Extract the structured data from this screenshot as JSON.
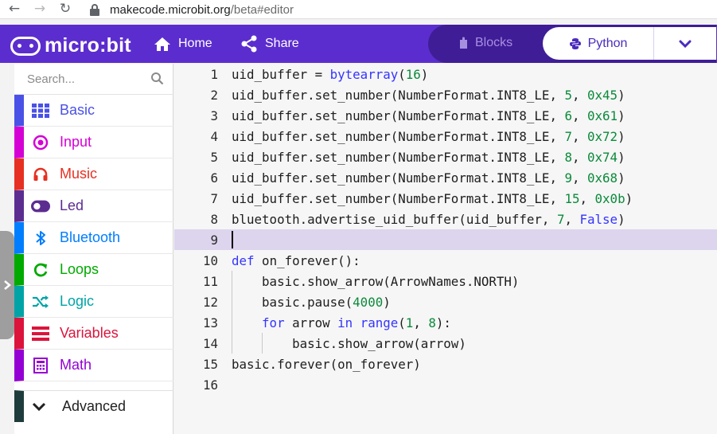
{
  "browser": {
    "url_host": "makecode.microbit.org",
    "url_path": "/beta#editor"
  },
  "menubar": {
    "logo_text": "micro:bit",
    "home_label": "Home",
    "share_label": "Share",
    "blocks_label": "Blocks",
    "python_label": "Python",
    "brand_color": "#5c2dce"
  },
  "toolbox": {
    "search_placeholder": "Search...",
    "categories": [
      {
        "label": "Basic",
        "color": "#4a51e6",
        "icon": "grid-icon"
      },
      {
        "label": "Input",
        "color": "#d400d4",
        "icon": "radio-target-icon"
      },
      {
        "label": "Music",
        "color": "#e63022",
        "icon": "headphones-icon"
      },
      {
        "label": "Led",
        "color": "#5c2d91",
        "icon": "toggle-icon"
      },
      {
        "label": "Bluetooth",
        "color": "#007eff",
        "icon": "bluetooth-icon"
      },
      {
        "label": "Loops",
        "color": "#00aa00",
        "icon": "refresh-icon"
      },
      {
        "label": "Logic",
        "color": "#00a4a6",
        "icon": "shuffle-icon"
      },
      {
        "label": "Variables",
        "color": "#dc143c",
        "icon": "list-icon"
      },
      {
        "label": "Math",
        "color": "#9400d3",
        "icon": "calculator-icon"
      }
    ],
    "advanced_label": "Advanced"
  },
  "editor": {
    "active_line": 9,
    "lines": [
      {
        "n": "1",
        "html": "uid_buffer = <span class='kw'>bytearray</span>(<span class='num'>16</span>)"
      },
      {
        "n": "2",
        "html": "uid_buffer.set_number(NumberFormat.INT8_LE, <span class='num'>5</span>, <span class='num'>0x45</span>)"
      },
      {
        "n": "3",
        "html": "uid_buffer.set_number(NumberFormat.INT8_LE, <span class='num'>6</span>, <span class='num'>0x61</span>)"
      },
      {
        "n": "4",
        "html": "uid_buffer.set_number(NumberFormat.INT8_LE, <span class='num'>7</span>, <span class='num'>0x72</span>)"
      },
      {
        "n": "5",
        "html": "uid_buffer.set_number(NumberFormat.INT8_LE, <span class='num'>8</span>, <span class='num'>0x74</span>)"
      },
      {
        "n": "6",
        "html": "uid_buffer.set_number(NumberFormat.INT8_LE, <span class='num'>9</span>, <span class='num'>0x68</span>)"
      },
      {
        "n": "7",
        "html": "uid_buffer.set_number(NumberFormat.INT8_LE, <span class='num'>15</span>, <span class='num'>0x0b</span>)"
      },
      {
        "n": "8",
        "html": "bluetooth.advertise_uid_buffer(uid_buffer, <span class='num'>7</span>, <span class='kw'>False</span>)"
      },
      {
        "n": "9",
        "html": ""
      },
      {
        "n": "10",
        "html": "<span class='kw'>def</span> on_forever():"
      },
      {
        "n": "11",
        "html": "    basic.show_arrow(ArrowNames.NORTH)"
      },
      {
        "n": "12",
        "html": "    basic.pause(<span class='num'>4000</span>)"
      },
      {
        "n": "13",
        "html": "    <span class='kw'>for</span> arrow <span class='kw'>in</span> <span class='kw'>range</span>(<span class='num'>1</span>, <span class='num'>8</span>):"
      },
      {
        "n": "14",
        "html": "        basic.show_arrow(arrow)"
      },
      {
        "n": "15",
        "html": "basic.forever(on_forever)"
      },
      {
        "n": "16",
        "html": ""
      }
    ]
  }
}
